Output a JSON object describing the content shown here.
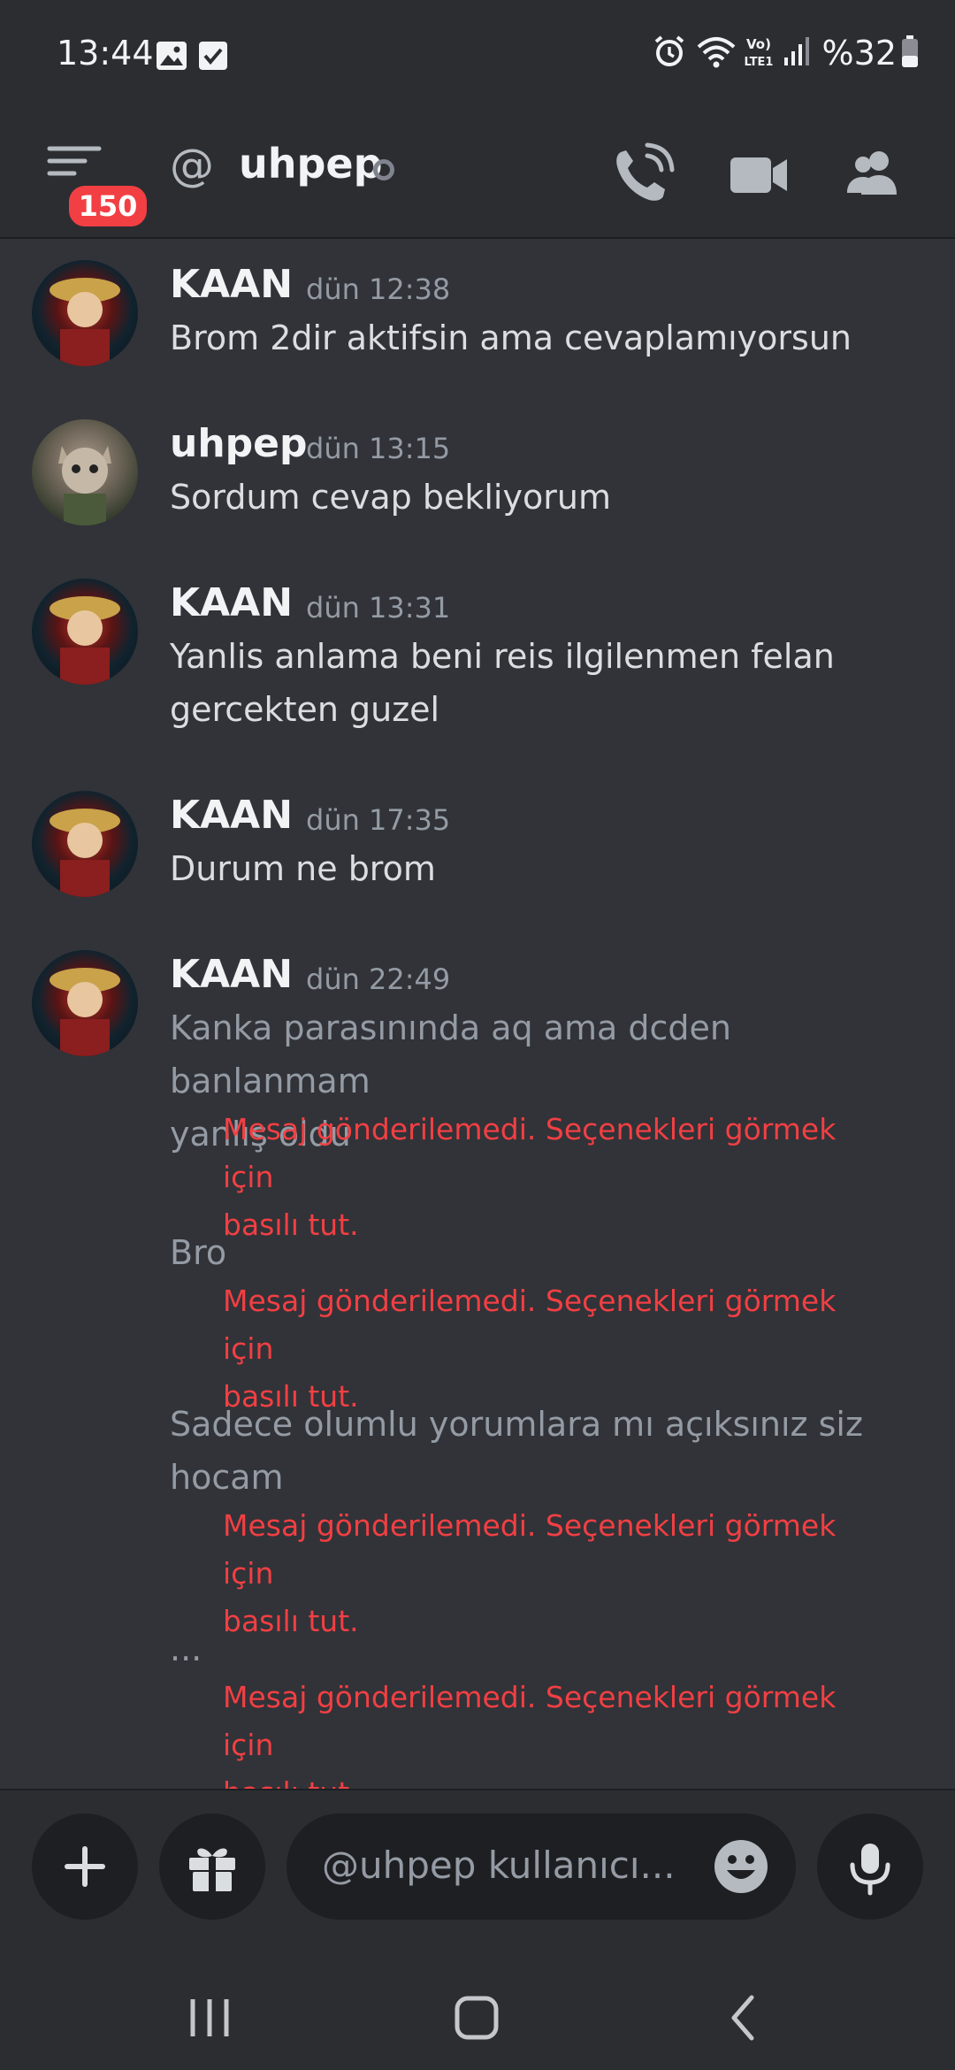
{
  "status_bar": {
    "time": "13:44",
    "battery": "%32"
  },
  "header": {
    "badge_count": "150",
    "at_symbol": "@",
    "username": "uhpep"
  },
  "messages": [
    {
      "author": "KAAN",
      "time": "dün 12:38",
      "lines": [
        "Brom 2dir aktifsin ama cevaplamıyorsun"
      ]
    },
    {
      "author": "uhpep",
      "time": "dün 13:15",
      "lines": [
        "Sordum cevap bekliyorum"
      ]
    },
    {
      "author": "KAAN",
      "time": "dün 13:31",
      "lines": [
        "Yanlis anlama beni reis ilgilenmen felan",
        "gercekten guzel"
      ]
    },
    {
      "author": "KAAN",
      "time": "dün 17:35",
      "lines": [
        "Durum ne brom"
      ]
    },
    {
      "author": "KAAN",
      "time": "dün 22:49",
      "lines": [
        "Kanka parasınında aq ama dcden banlanmam",
        "yanlış oldu"
      ]
    }
  ],
  "failed_messages": [
    {
      "text_lines": [
        "Bro"
      ]
    },
    {
      "text_lines": [
        "Sadece olumlu yorumlara mı açıksınız siz",
        "hocam"
      ]
    },
    {
      "text_lines": [
        "..."
      ]
    }
  ],
  "error": {
    "line1": "Mesaj gönderilemedi. Seçenekleri görmek için",
    "line2": "basılı tut."
  },
  "composer": {
    "placeholder": "@uhpep kullanıcı..."
  },
  "colors": {
    "background": "#313338",
    "bars": "#2b2d31",
    "error_red": "#f23f43",
    "muted": "#949ba4"
  },
  "icons": {
    "status_left": [
      "image-icon",
      "check-box-icon"
    ],
    "status_right": [
      "alarm-icon",
      "wifi-icon",
      "volte-icon",
      "signal-icon",
      "battery-icon"
    ],
    "header": [
      "menu-icon",
      "voice-call-icon",
      "video-call-icon",
      "members-icon"
    ],
    "composer": [
      "plus-icon",
      "gift-icon",
      "emoji-icon",
      "microphone-icon"
    ],
    "nav": [
      "recent-apps-icon",
      "home-icon",
      "back-icon"
    ]
  }
}
